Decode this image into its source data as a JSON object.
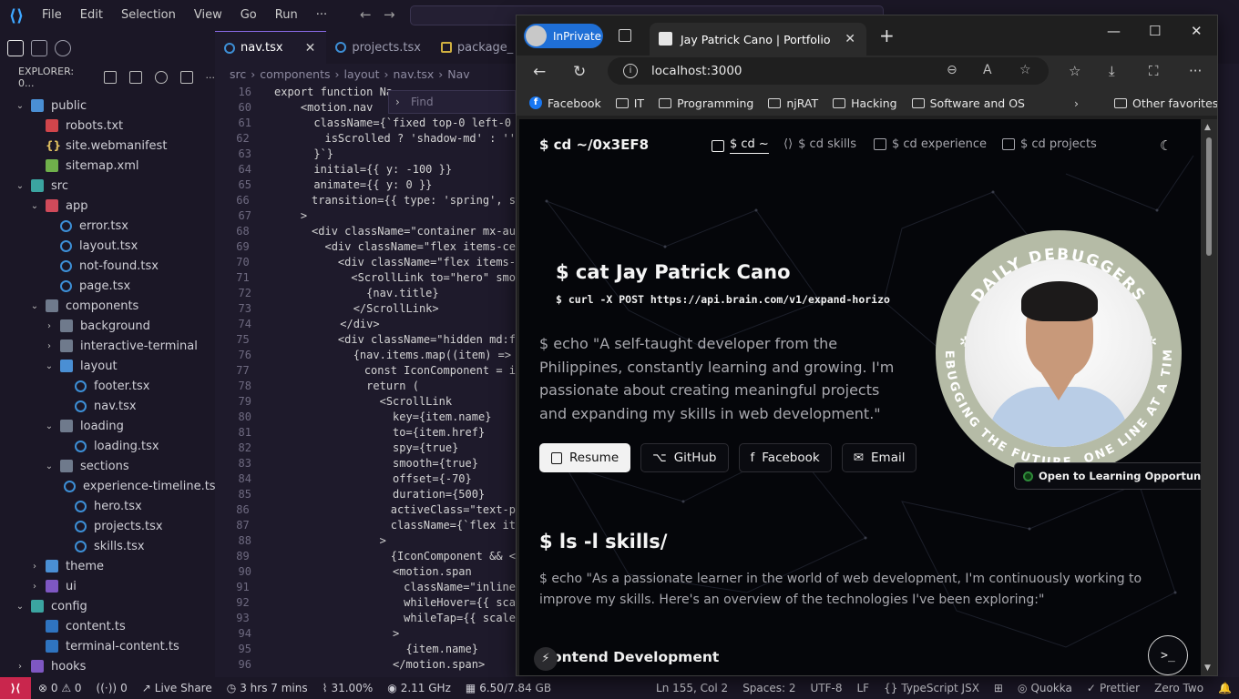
{
  "vscode": {
    "menu": [
      "File",
      "Edit",
      "Selection",
      "View",
      "Go",
      "Run"
    ],
    "menu_more": "···",
    "command_center": "",
    "explorer_title": "EXPLORER: 0...",
    "tree": [
      {
        "label": "public",
        "depth": 1,
        "kind": "folder-open",
        "icon": "folder-blue"
      },
      {
        "label": "robots.txt",
        "depth": 2,
        "kind": "file",
        "icon": "txt"
      },
      {
        "label": "site.webmanifest",
        "depth": 2,
        "kind": "file",
        "icon": "brace"
      },
      {
        "label": "sitemap.xml",
        "depth": 2,
        "kind": "file",
        "icon": "xml"
      },
      {
        "label": "src",
        "depth": 1,
        "kind": "folder-open",
        "icon": "folder-teal"
      },
      {
        "label": "app",
        "depth": 2,
        "kind": "folder-open",
        "icon": "folder-red"
      },
      {
        "label": "error.tsx",
        "depth": 3,
        "kind": "file",
        "icon": "tsx"
      },
      {
        "label": "layout.tsx",
        "depth": 3,
        "kind": "file",
        "icon": "tsx"
      },
      {
        "label": "not-found.tsx",
        "depth": 3,
        "kind": "file",
        "icon": "tsx"
      },
      {
        "label": "page.tsx",
        "depth": 3,
        "kind": "file",
        "icon": "tsx"
      },
      {
        "label": "components",
        "depth": 2,
        "kind": "folder-open",
        "icon": "folder"
      },
      {
        "label": "background",
        "depth": 3,
        "kind": "folder-closed",
        "icon": "folder"
      },
      {
        "label": "interactive-terminal",
        "depth": 3,
        "kind": "folder-closed",
        "icon": "folder"
      },
      {
        "label": "layout",
        "depth": 3,
        "kind": "folder-open",
        "icon": "folder-blue"
      },
      {
        "label": "footer.tsx",
        "depth": 4,
        "kind": "file",
        "icon": "tsx"
      },
      {
        "label": "nav.tsx",
        "depth": 4,
        "kind": "file",
        "icon": "tsx"
      },
      {
        "label": "loading",
        "depth": 3,
        "kind": "folder-open",
        "icon": "folder"
      },
      {
        "label": "loading.tsx",
        "depth": 4,
        "kind": "file",
        "icon": "tsx"
      },
      {
        "label": "sections",
        "depth": 3,
        "kind": "folder-open",
        "icon": "folder"
      },
      {
        "label": "experience-timeline.tsx",
        "depth": 4,
        "kind": "file",
        "icon": "tsx"
      },
      {
        "label": "hero.tsx",
        "depth": 4,
        "kind": "file",
        "icon": "tsx"
      },
      {
        "label": "projects.tsx",
        "depth": 4,
        "kind": "file",
        "icon": "tsx"
      },
      {
        "label": "skills.tsx",
        "depth": 4,
        "kind": "file",
        "icon": "tsx"
      },
      {
        "label": "theme",
        "depth": 2,
        "kind": "folder-closed",
        "icon": "folder-blue"
      },
      {
        "label": "ui",
        "depth": 2,
        "kind": "folder-closed",
        "icon": "folder-purple"
      },
      {
        "label": "config",
        "depth": 1,
        "kind": "folder-open",
        "icon": "folder-teal"
      },
      {
        "label": "content.ts",
        "depth": 2,
        "kind": "file",
        "icon": "ts"
      },
      {
        "label": "terminal-content.ts",
        "depth": 2,
        "kind": "file",
        "icon": "ts"
      },
      {
        "label": "hooks",
        "depth": 1,
        "kind": "folder-closed",
        "icon": "folder-purple"
      }
    ],
    "tabs": [
      {
        "label": "nav.tsx",
        "active": true,
        "close": "✕"
      },
      {
        "label": "projects.tsx",
        "active": false,
        "close": ""
      },
      {
        "label": "package_",
        "active": false,
        "close": ""
      }
    ],
    "breadcrumb": [
      "src",
      "components",
      "layout",
      "nav.tsx",
      "Nav"
    ],
    "find_placeholder": "Find",
    "code": [
      {
        "n": "16",
        "t": "export function Na"
      },
      {
        "n": "60",
        "t": "    <motion.nav"
      },
      {
        "n": "61",
        "t": "      className={`fixed top-0 left-0"
      },
      {
        "n": "62",
        "t": "        isScrolled ? 'shadow-md' : ''"
      },
      {
        "n": "63",
        "t": "      }`}"
      },
      {
        "n": "64",
        "t": "      initial={{ y: -100 }}"
      },
      {
        "n": "65",
        "t": "      animate={{ y: 0 }}"
      },
      {
        "n": "66",
        "t": "      transition={{ type: 'spring', s"
      },
      {
        "n": "67",
        "t": "    >"
      },
      {
        "n": "68",
        "t": "      <div className=\"container mx-au"
      },
      {
        "n": "69",
        "t": "        <div className=\"flex items-ce"
      },
      {
        "n": "70",
        "t": "          <div className=\"flex items-"
      },
      {
        "n": "71",
        "t": "            <ScrollLink to=\"hero\" smo"
      },
      {
        "n": "72",
        "t": "              {nav.title}"
      },
      {
        "n": "73",
        "t": "            </ScrollLink>"
      },
      {
        "n": "74",
        "t": "          </div>"
      },
      {
        "n": "75",
        "t": "          <div className=\"hidden md:f"
      },
      {
        "n": "76",
        "t": "            {nav.items.map((item) =>"
      },
      {
        "n": "77",
        "t": "              const IconComponent = i"
      },
      {
        "n": "78",
        "t": "              return ("
      },
      {
        "n": "79",
        "t": "                <ScrollLink"
      },
      {
        "n": "80",
        "t": "                  key={item.name}"
      },
      {
        "n": "81",
        "t": "                  to={item.href}"
      },
      {
        "n": "82",
        "t": "                  spy={true}"
      },
      {
        "n": "83",
        "t": "                  smooth={true}"
      },
      {
        "n": "84",
        "t": "                  offset={-70}"
      },
      {
        "n": "85",
        "t": "                  duration={500}"
      },
      {
        "n": "86",
        "t": "                  activeClass=\"text-p"
      },
      {
        "n": "87",
        "t": "                  className={`flex it"
      },
      {
        "n": "88",
        "t": "                >"
      },
      {
        "n": "89",
        "t": "                  {IconComponent && <"
      },
      {
        "n": "90",
        "t": "                  <motion.span"
      },
      {
        "n": "91",
        "t": "                    className=\"inline"
      },
      {
        "n": "92",
        "t": "                    whileHover={{ sca"
      },
      {
        "n": "93",
        "t": "                    whileTap={{ scale"
      },
      {
        "n": "94",
        "t": "                  >"
      },
      {
        "n": "95",
        "t": "                    {item.name}"
      },
      {
        "n": "96",
        "t": "                  </motion.span>"
      }
    ],
    "status": {
      "remote": "⟩⟨",
      "problems": "⊗ 0 ⚠ 0",
      "ports": "0",
      "live_share": "Live Share",
      "time": "3 hrs 7 mins",
      "cpu": "31.00%",
      "freq": "2.11 GHz",
      "mem": "6.50/7.84 GB",
      "cursor": "Ln 155, Col 2",
      "spaces": "Spaces: 2",
      "encoding": "UTF-8",
      "eol": "LF",
      "language": "TypeScript JSX",
      "quokka": "Quokka",
      "prettier": "Prettier",
      "theme": "Zero Two"
    }
  },
  "browser": {
    "inprivate_label": "InPrivate",
    "tab_title": "Jay Patrick Cano | Portfolio",
    "url": "localhost:3000",
    "bookmarks": [
      {
        "label": "Facebook",
        "type": "facebook"
      },
      {
        "label": "IT",
        "type": "folder"
      },
      {
        "label": "Programming",
        "type": "folder"
      },
      {
        "label": "njRAT",
        "type": "folder"
      },
      {
        "label": "Hacking",
        "type": "folder"
      },
      {
        "label": "Software and OS",
        "type": "folder"
      }
    ],
    "other_favorites": "Other favorites"
  },
  "portfolio": {
    "logo": "$ cd ~/0x3EF8",
    "nav": [
      {
        "label": "$ cd ~",
        "icon": "home-icon",
        "active": true
      },
      {
        "label": "$ cd skills",
        "icon": "code-icon",
        "active": false
      },
      {
        "label": "$ cd experience",
        "icon": "briefcase-icon",
        "active": false
      },
      {
        "label": "$ cd projects",
        "icon": "folder-icon",
        "active": false
      }
    ],
    "hero_title": "$ cat Jay Patrick Cano",
    "hero_cmd": "$ curl -X POST https://api.brain.com/v1/expand-horizo",
    "hero_bio": "$ echo \"A self-taught developer from the Philippines, constantly learning and growing. I'm passionate about creating meaningful projects and expanding my skills in web development.\"",
    "buttons": [
      {
        "label": "Resume",
        "primary": true
      },
      {
        "label": "GitHub",
        "primary": false
      },
      {
        "label": "Facebook",
        "primary": false
      },
      {
        "label": "Email",
        "primary": false
      }
    ],
    "badge_top_text": "DAILY DEBUGGERS",
    "badge_bottom_text": "DEBUGGING THE FUTURE, ONE LINE AT A TIME",
    "status_badge": "Open to Learning Opportunities",
    "skills_title": "$ ls -l skills/",
    "skills_text": "$ echo \"As a passionate learner in the world of web development, I'm continuously working to improve my skills. Here's an overview of the technologies I've been exploring:\"",
    "frontend_heading": "ontend Development",
    "terminal_button": ">_"
  }
}
